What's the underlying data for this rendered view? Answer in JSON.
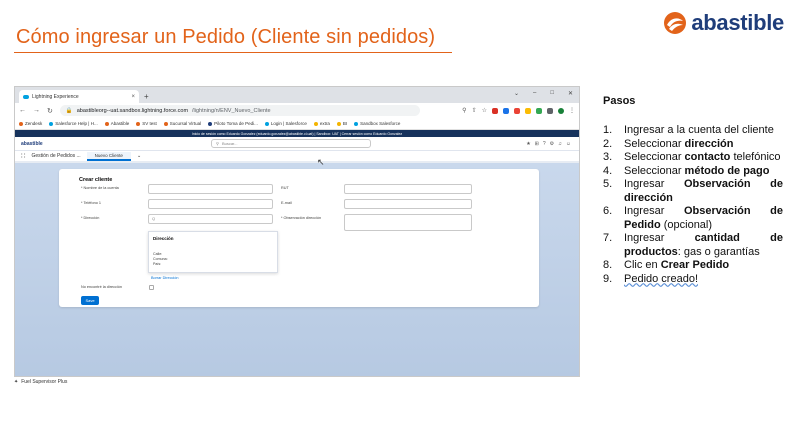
{
  "slide": {
    "title": "Cómo ingresar un Pedido (Cliente sin pedidos)",
    "logo_text": "abastible",
    "caption": "Fuel Supervisor Plus"
  },
  "browser": {
    "tab_title": "Lightning Experience",
    "tab_close": "×",
    "new_tab": "+",
    "url_host": "abastibleorg--uat.sandbox.lightning.force.com",
    "url_path": "/lightning/n/ENV_Nuevo_Cliente",
    "bookmarks": [
      "Zendesk",
      "Salesforce Help | H...",
      "Abastible",
      "SV test",
      "Sucursal Virtual",
      "Piloto Toma de Pedi...",
      "Login | Salesforce",
      "extra",
      "BI",
      "Sandbox Salesforce"
    ]
  },
  "salesforce": {
    "banner": "Inicio de sesión como Eduardo Gonzalez (eduardo.gonzalez@abastible.cl.uat) | Sandbox: UAT | Cerrar sesión como Eduardo Gonzalez",
    "logo": "abastible",
    "search_placeholder": "Buscar...",
    "app_name": "Gestión de Pedidos ...",
    "active_tab": "Nuevo Cliente",
    "form": {
      "title": "Crear cliente",
      "fields": {
        "nombre": "* Nombre de la cuenta",
        "rut": "RUT",
        "telefono": "* Teléfono 1",
        "email": "E-mail",
        "direccion": "* Dirección",
        "observacion": "* Observación dirección"
      },
      "search_icon": "Q",
      "dropdown_title": "Dirección",
      "dropdown_items": [
        "Calle:",
        "Comuna:",
        "País:"
      ],
      "link_borrar": "Borrar Dirección",
      "no_encontre": "No encontré la dirección",
      "save_label": "Save"
    }
  },
  "steps": {
    "heading": "Pasos",
    "items": [
      {
        "num": "1.",
        "pre": "Ingresar a la cuenta del cliente",
        "bold": "",
        "post": ""
      },
      {
        "num": "2.",
        "pre": "Seleccionar ",
        "bold": "dirección",
        "post": ""
      },
      {
        "num": "3.",
        "pre": "Seleccionar ",
        "bold": "contacto",
        "post": " telefónico"
      },
      {
        "num": "4.",
        "pre": "Seleccionar ",
        "bold": "método de pago",
        "post": ""
      },
      {
        "num": "5.",
        "pre": "Ingresar ",
        "bold": "Observación de dirección",
        "post": ""
      },
      {
        "num": "6.",
        "pre": "Ingresar ",
        "bold": "Observación de Pedido",
        "post": " (opcional)"
      },
      {
        "num": "7.",
        "pre": "Ingresar ",
        "bold": "cantidad de productos",
        "post": ": gas o garantías"
      },
      {
        "num": "8.",
        "pre": "Clic en ",
        "bold": "Crear Pedido",
        "post": ""
      },
      {
        "num": "9.",
        "pre": "",
        "bold": "",
        "post": "",
        "wavy": "Pedido creado!"
      }
    ]
  },
  "colors": {
    "title_orange": "#e2631a",
    "brand_blue": "#1f3d7a",
    "sf_blue": "#0070d2"
  }
}
